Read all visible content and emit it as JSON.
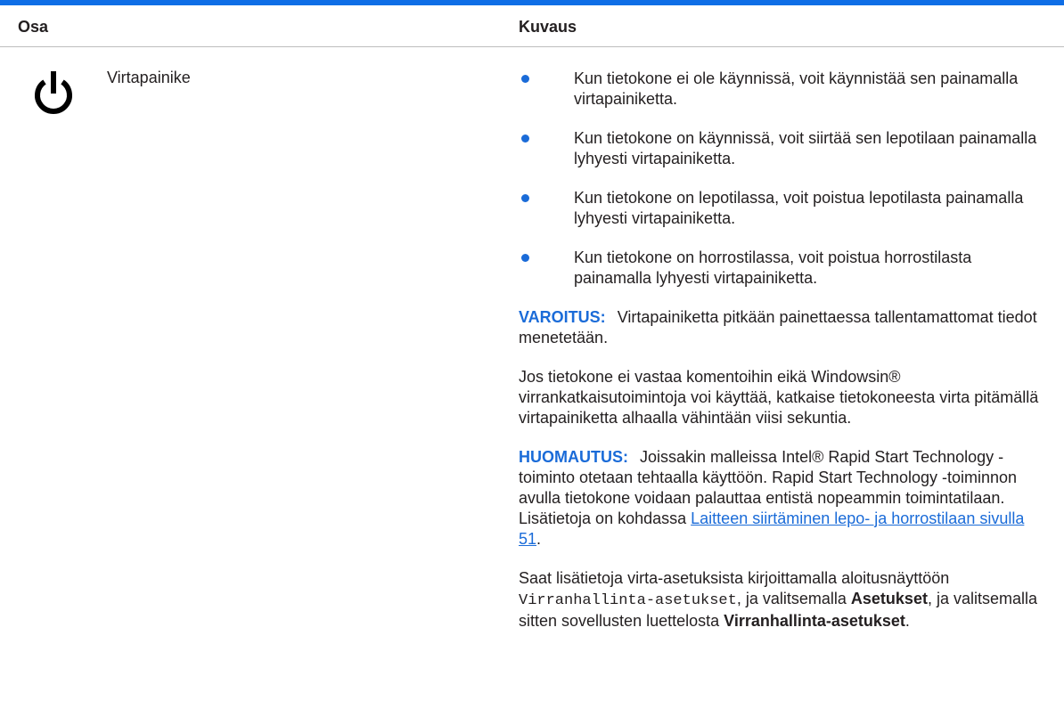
{
  "colors": {
    "accent": "#0f6ee6",
    "label": "#1a6bd8"
  },
  "table": {
    "headers": {
      "component": "Osa",
      "description": "Kuvaus"
    },
    "row": {
      "icon": "power-icon",
      "name": "Virtapainike",
      "bullets": [
        "Kun tietokone ei ole käynnissä, voit käynnistää sen painamalla virtapainiketta.",
        "Kun tietokone on käynnissä, voit siirtää sen lepotilaan painamalla lyhyesti virtapainiketta.",
        "Kun tietokone on lepotilassa, voit poistua lepotilasta painamalla lyhyesti virtapainiketta.",
        "Kun tietokone on horrostilassa, voit poistua horrostilasta painamalla lyhyesti virtapainiketta."
      ],
      "warning": {
        "label": "VAROITUS:",
        "text": "Virtapainiketta pitkään painettaessa tallentamattomat tiedot menetetään."
      },
      "unresponsive_text": "Jos tietokone ei vastaa komentoihin eikä Windowsin® virrankatkaisutoimintoja voi käyttää, katkaise tietokoneesta virta pitämällä virtapainiketta alhaalla vähintään viisi sekuntia.",
      "note": {
        "label": "HUOMAUTUS:",
        "text": "Joissakin malleissa Intel® Rapid Start Technology -toiminto otetaan tehtaalla käyttöön. Rapid Start Technology -toiminnon avulla tietokone voidaan palauttaa entistä nopeammin toimintatilaan. Lisätietoja on kohdassa",
        "link": "Laitteen siirtäminen lepo- ja horrostilaan sivulla 51",
        "after_link": "."
      },
      "settings": {
        "intro": "Saat lisätietoja virta-asetuksista kirjoittamalla aloitusnäyttöön",
        "command": "Virranhallinta-asetukset",
        "mid1": ", ja valitsemalla",
        "bold1": "Asetukset",
        "mid2": ", ja valitsemalla sitten sovellusten luettelosta",
        "bold2": "Virranhallinta-asetukset",
        "end": "."
      }
    }
  }
}
